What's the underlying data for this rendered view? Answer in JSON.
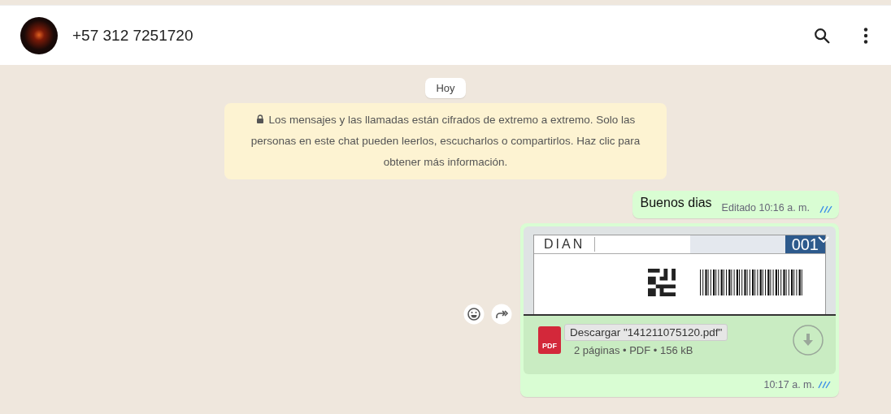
{
  "header": {
    "contact": "+57 312 7251720"
  },
  "date_chip": "Hoy",
  "encryption_notice": "Los mensajes y las llamadas están cifrados de extremo a extremo. Solo las personas en este chat pueden leerlos, escucharlos o compartirlos. Haz clic para obtener más información.",
  "messages": [
    {
      "kind": "text",
      "text": "Buenos dias",
      "meta": "Editado 10:16 a. m.",
      "read": true
    },
    {
      "kind": "document",
      "preview": {
        "logo": "DIAN",
        "number": "001"
      },
      "file_icon": "PDF",
      "tooltip": "Descargar \"141211075120.pdf\"",
      "details": "2 páginas • PDF • 156 kB",
      "meta": "10:17 a. m.",
      "read": true
    }
  ]
}
